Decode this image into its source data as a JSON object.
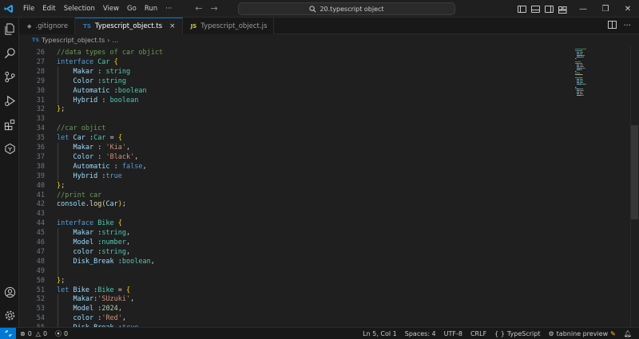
{
  "titlebar": {
    "menu": [
      "File",
      "Edit",
      "Selection",
      "View",
      "Go",
      "Run",
      "···"
    ],
    "search_text": "20.typescript object"
  },
  "tabs": [
    {
      "badge": "◆",
      "label": ".gitignore",
      "badge_color": "#8b8b8b"
    },
    {
      "badge": "TS",
      "label": "Typescript_object.ts",
      "badge_color": "#3178c6",
      "close": "×"
    },
    {
      "badge": "JS",
      "label": "Typescript_object.js",
      "badge_color": "#cbcb41"
    }
  ],
  "breadcrumb": {
    "badge": "TS",
    "file": "Typescript_object.ts",
    "sep": "›",
    "rest": "..."
  },
  "editor": {
    "lines": [
      {
        "n": "26",
        "tokens": [
          [
            "cmt",
            "//data types of car objict"
          ]
        ]
      },
      {
        "n": "27",
        "tokens": [
          [
            "kw",
            "interface "
          ],
          [
            "type",
            "Car "
          ],
          [
            "br",
            "{"
          ]
        ]
      },
      {
        "n": "28",
        "tokens": [
          [
            "p",
            "    "
          ],
          [
            "var",
            "Makar "
          ],
          [
            "p",
            ": "
          ],
          [
            "type",
            "string"
          ]
        ]
      },
      {
        "n": "29",
        "tokens": [
          [
            "p",
            "    "
          ],
          [
            "var",
            "Color "
          ],
          [
            "p",
            ":"
          ],
          [
            "type",
            "string"
          ]
        ]
      },
      {
        "n": "30",
        "tokens": [
          [
            "p",
            "    "
          ],
          [
            "var",
            "Automatic "
          ],
          [
            "p",
            ":"
          ],
          [
            "type",
            "boolean"
          ]
        ]
      },
      {
        "n": "31",
        "tokens": [
          [
            "p",
            "    "
          ],
          [
            "var",
            "Hybrid "
          ],
          [
            "p",
            ": "
          ],
          [
            "type",
            "boolean"
          ]
        ]
      },
      {
        "n": "32",
        "tokens": [
          [
            "br",
            "}"
          ],
          [
            "p",
            ";"
          ]
        ]
      },
      {
        "n": "33",
        "tokens": []
      },
      {
        "n": "34",
        "tokens": [
          [
            "cmt",
            "//car objict"
          ]
        ]
      },
      {
        "n": "35",
        "tokens": [
          [
            "kw",
            "let "
          ],
          [
            "var",
            "Car "
          ],
          [
            "p",
            ":"
          ],
          [
            "type",
            "Car "
          ],
          [
            "p",
            "= "
          ],
          [
            "br",
            "{"
          ]
        ]
      },
      {
        "n": "36",
        "tokens": [
          [
            "p",
            "    "
          ],
          [
            "var",
            "Makar "
          ],
          [
            "p",
            ": "
          ],
          [
            "str",
            "'Kia'"
          ],
          [
            "p",
            ","
          ]
        ]
      },
      {
        "n": "37",
        "tokens": [
          [
            "p",
            "    "
          ],
          [
            "var",
            "Color "
          ],
          [
            "p",
            ": "
          ],
          [
            "str",
            "'Black'"
          ],
          [
            "p",
            ","
          ]
        ]
      },
      {
        "n": "38",
        "tokens": [
          [
            "p",
            "    "
          ],
          [
            "var",
            "Automatic "
          ],
          [
            "p",
            ": "
          ],
          [
            "kw",
            "false"
          ],
          [
            "p",
            ","
          ]
        ]
      },
      {
        "n": "39",
        "tokens": [
          [
            "p",
            "    "
          ],
          [
            "var",
            "Hybrid "
          ],
          [
            "p",
            ":"
          ],
          [
            "kw",
            "true"
          ]
        ]
      },
      {
        "n": "40",
        "tokens": [
          [
            "br",
            "}"
          ],
          [
            "p",
            ";"
          ]
        ]
      },
      {
        "n": "41",
        "tokens": [
          [
            "cmt",
            "//print car"
          ]
        ]
      },
      {
        "n": "42",
        "tokens": [
          [
            "var",
            "console"
          ],
          [
            "p",
            "."
          ],
          [
            "fn",
            "log"
          ],
          [
            "br",
            "("
          ],
          [
            "var",
            "Car"
          ],
          [
            "br",
            ")"
          ],
          [
            "p",
            ";"
          ]
        ]
      },
      {
        "n": "43",
        "tokens": []
      },
      {
        "n": "44",
        "tokens": [
          [
            "kw",
            "interface "
          ],
          [
            "type",
            "Bike "
          ],
          [
            "br",
            "{"
          ]
        ]
      },
      {
        "n": "45",
        "tokens": [
          [
            "p",
            "    "
          ],
          [
            "var",
            "Makar "
          ],
          [
            "p",
            ":"
          ],
          [
            "type",
            "string"
          ],
          [
            "p",
            ","
          ]
        ]
      },
      {
        "n": "46",
        "tokens": [
          [
            "p",
            "    "
          ],
          [
            "var",
            "Model "
          ],
          [
            "p",
            ":"
          ],
          [
            "type",
            "number"
          ],
          [
            "p",
            ","
          ]
        ]
      },
      {
        "n": "47",
        "tokens": [
          [
            "p",
            "    "
          ],
          [
            "var",
            "color "
          ],
          [
            "p",
            ":"
          ],
          [
            "type",
            "string"
          ],
          [
            "p",
            ","
          ]
        ]
      },
      {
        "n": "48",
        "tokens": [
          [
            "p",
            "    "
          ],
          [
            "var",
            "Disk_Break "
          ],
          [
            "p",
            ":"
          ],
          [
            "type",
            "boolean"
          ],
          [
            "p",
            ","
          ]
        ]
      },
      {
        "n": "49",
        "tokens": []
      },
      {
        "n": "50",
        "tokens": [
          [
            "br",
            "}"
          ],
          [
            "p",
            ";"
          ]
        ]
      },
      {
        "n": "51",
        "tokens": [
          [
            "kw",
            "let "
          ],
          [
            "var",
            "Bike "
          ],
          [
            "p",
            ":"
          ],
          [
            "type",
            "Bike "
          ],
          [
            "p",
            "= "
          ],
          [
            "br",
            "{"
          ]
        ]
      },
      {
        "n": "52",
        "tokens": [
          [
            "p",
            "    "
          ],
          [
            "var",
            "Makar"
          ],
          [
            "p",
            ":"
          ],
          [
            "str",
            "'SUzuki'"
          ],
          [
            "p",
            ","
          ]
        ]
      },
      {
        "n": "53",
        "tokens": [
          [
            "p",
            "    "
          ],
          [
            "var",
            "Model "
          ],
          [
            "p",
            ":"
          ],
          [
            "num",
            "2024"
          ],
          [
            "p",
            ","
          ]
        ]
      },
      {
        "n": "54",
        "tokens": [
          [
            "p",
            "    "
          ],
          [
            "var",
            "color "
          ],
          [
            "p",
            ":"
          ],
          [
            "str",
            "'Red'"
          ],
          [
            "p",
            ","
          ]
        ]
      },
      {
        "n": "55",
        "tokens": [
          [
            "p",
            "    "
          ],
          [
            "var",
            "Disk_Break "
          ],
          [
            "p",
            ":"
          ],
          [
            "kw",
            "true"
          ]
        ]
      }
    ]
  },
  "statusbar": {
    "errors": "0",
    "warnings": "0",
    "ports": "0",
    "position": "Ln 5, Col 1",
    "spaces": "Spaces: 4",
    "encoding": "UTF-8",
    "eol": "CRLF",
    "braces": "{ }",
    "language": "TypeScript",
    "tabnine": "tabnine preview"
  },
  "colors": {
    "accent": "#0078d4",
    "ts": "#3178c6",
    "js": "#cbcb41"
  }
}
